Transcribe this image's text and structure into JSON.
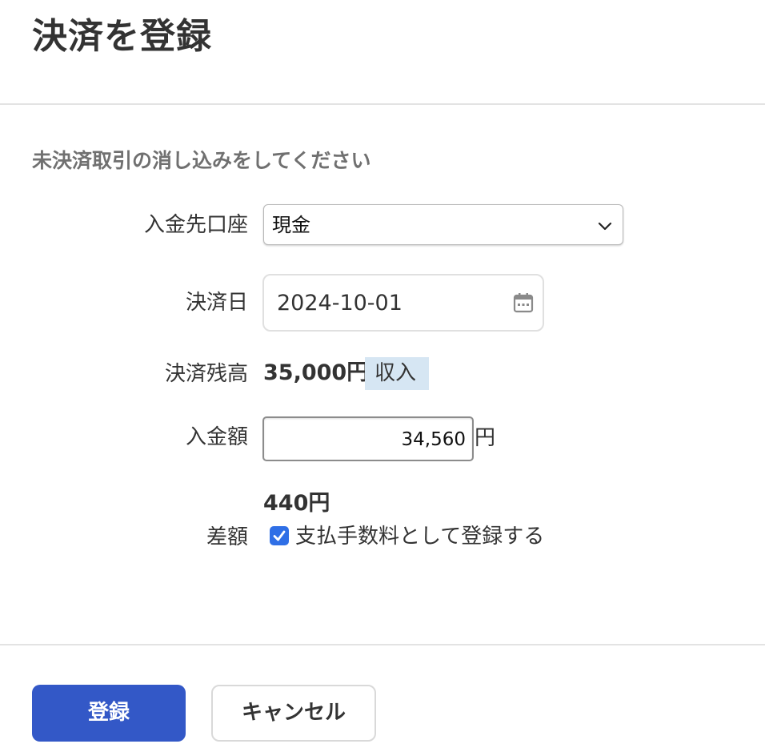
{
  "header": {
    "title": "決済を登録"
  },
  "form": {
    "instruction": "未決済取引の消し込みをしてください",
    "account": {
      "label": "入金先口座",
      "selected": "現金",
      "chevron_icon": "chevron-down-icon"
    },
    "date": {
      "label": "決済日",
      "value": "2024-10-01",
      "calendar_icon": "calendar-icon"
    },
    "balance": {
      "label": "決済残高",
      "amount": "35,000円",
      "badge": "収入"
    },
    "deposit": {
      "label": "入金額",
      "value": "34,560",
      "unit": "円"
    },
    "difference": {
      "label": "差額",
      "amount": "440円",
      "checkbox_checked": true,
      "checkbox_label": "支払手数料として登録する"
    }
  },
  "footer": {
    "submit_label": "登録",
    "cancel_label": "キャンセル"
  },
  "colors": {
    "primary": "#3358c7",
    "checkbox": "#2f6fe6",
    "badge_bg": "#d6e6f3"
  }
}
